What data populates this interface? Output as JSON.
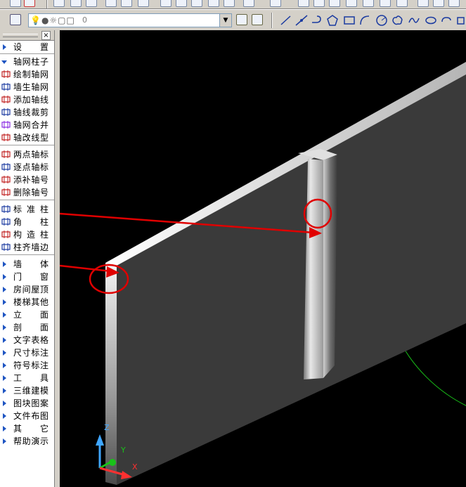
{
  "layer_toolbar": {
    "layer_value": "0"
  },
  "panel": {
    "close_glyph": "×",
    "items": [
      {
        "label": "设　置",
        "kind": "menu"
      },
      {
        "label": "轴网柱子",
        "kind": "expanded"
      },
      {
        "label": "绘制轴网",
        "kind": "cmd",
        "icon": "grid-icon"
      },
      {
        "label": "墙生轴网",
        "kind": "cmd",
        "icon": "wall-to-grid-icon"
      },
      {
        "label": "添加轴线",
        "kind": "cmd",
        "icon": "add-axis-icon"
      },
      {
        "label": "轴线裁剪",
        "kind": "cmd",
        "icon": "trim-axis-icon"
      },
      {
        "label": "轴网合并",
        "kind": "cmd",
        "icon": "merge-grid-icon"
      },
      {
        "label": "轴改线型",
        "kind": "cmd",
        "icon": "axis-linetype-icon",
        "sep_after": true
      },
      {
        "label": "两点轴标",
        "kind": "cmd",
        "icon": "two-point-axis-label-icon"
      },
      {
        "label": "逐点轴标",
        "kind": "cmd",
        "icon": "point-axis-label-icon"
      },
      {
        "label": "添补轴号",
        "kind": "cmd",
        "icon": "add-axis-number-icon"
      },
      {
        "label": "删除轴号",
        "kind": "cmd",
        "icon": "delete-axis-number-icon",
        "sep_after": true
      },
      {
        "label": "标 准 柱",
        "kind": "cmd",
        "icon": "standard-column-icon"
      },
      {
        "label": "角　柱",
        "kind": "cmd",
        "icon": "corner-column-icon"
      },
      {
        "label": "构 造 柱",
        "kind": "cmd",
        "icon": "structural-column-icon"
      },
      {
        "label": "柱齐墙边",
        "kind": "cmd",
        "icon": "align-column-icon",
        "sep_after": true
      },
      {
        "label": "墙　体",
        "kind": "menu"
      },
      {
        "label": "门　窗",
        "kind": "menu"
      },
      {
        "label": "房间屋顶",
        "kind": "menu"
      },
      {
        "label": "楼梯其他",
        "kind": "menu"
      },
      {
        "label": "立　面",
        "kind": "menu"
      },
      {
        "label": "剖　面",
        "kind": "menu"
      },
      {
        "label": "文字表格",
        "kind": "menu"
      },
      {
        "label": "尺寸标注",
        "kind": "menu"
      },
      {
        "label": "符号标注",
        "kind": "menu"
      },
      {
        "label": "工　具",
        "kind": "menu"
      },
      {
        "label": "三维建模",
        "kind": "menu"
      },
      {
        "label": "图块图案",
        "kind": "menu"
      },
      {
        "label": "文件布图",
        "kind": "menu"
      },
      {
        "label": "其　它",
        "kind": "menu"
      },
      {
        "label": "帮助演示",
        "kind": "menu"
      }
    ]
  },
  "ucs": {
    "x_label": "X",
    "y_label": "Y",
    "z_label": "Z"
  },
  "colors": {
    "annotation_red": "#e00000",
    "circle_green": "#19c219",
    "menu_arrow_blue": "#1f55c2",
    "viewport_bg": "#000000"
  }
}
